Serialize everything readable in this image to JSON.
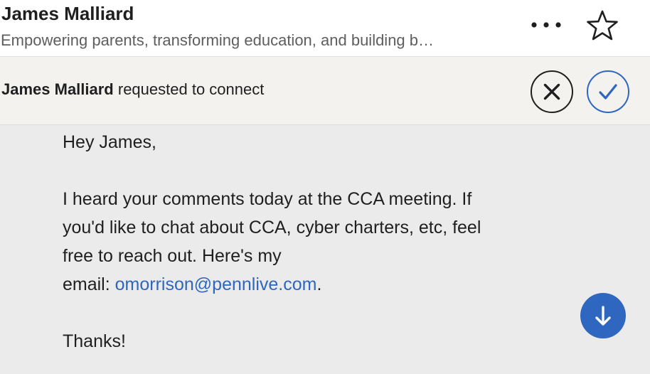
{
  "header": {
    "name": "James Malliard",
    "headline": "Empowering parents, transforming education, and building b…",
    "more_icon": "more-horizontal-icon",
    "star_icon": "star-outline-icon"
  },
  "request": {
    "requester_name": "James Malliard",
    "request_text": " requested to connect",
    "decline_icon": "close-icon",
    "accept_icon": "checkmark-icon"
  },
  "message": {
    "greeting": "Hey James,",
    "line1": "I heard your comments today at the CCA meeting. If",
    "line2": "you'd like to chat about CCA, cyber charters, etc, feel",
    "line3": "free to reach out. Here's my",
    "email_prefix": "email: ",
    "email": "omorrison@pennlive.com",
    "email_suffix": ".",
    "signoff": "Thanks!",
    "scroll_icon": "arrow-down-icon"
  },
  "colors": {
    "accent": "#2f67c0",
    "header_bg": "#ffffff",
    "request_bg": "#f3f2ef",
    "message_bg": "#ebebeb",
    "text": "#1f1f1f",
    "muted_text": "#5e5e5e"
  }
}
